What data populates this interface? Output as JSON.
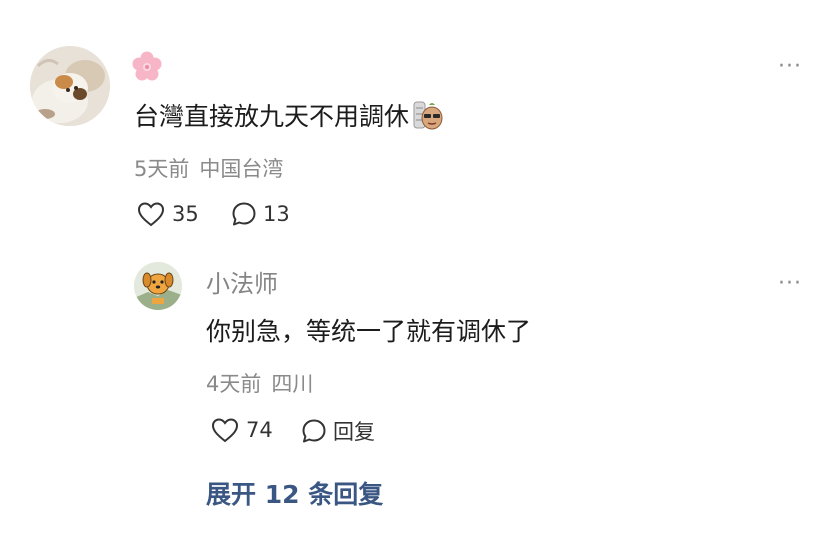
{
  "comment": {
    "username_emoji": "🌸",
    "text": "台灣直接放九天不用調休",
    "sticker": "sweet-potato-sunglasses-sticker",
    "time": "5天前",
    "location": "中国台湾",
    "likes": "35",
    "comments": "13",
    "more": "···"
  },
  "reply": {
    "username": "小法师",
    "text": "你别急，等统一了就有调休了",
    "time": "4天前",
    "location": "四川",
    "likes": "74",
    "reply_label": "回复",
    "more": "···"
  },
  "expand_label": "展开 12 条回复",
  "colors": {
    "link": "#3a5683",
    "meta": "#8a8a8a",
    "text": "#1c1c1c"
  }
}
